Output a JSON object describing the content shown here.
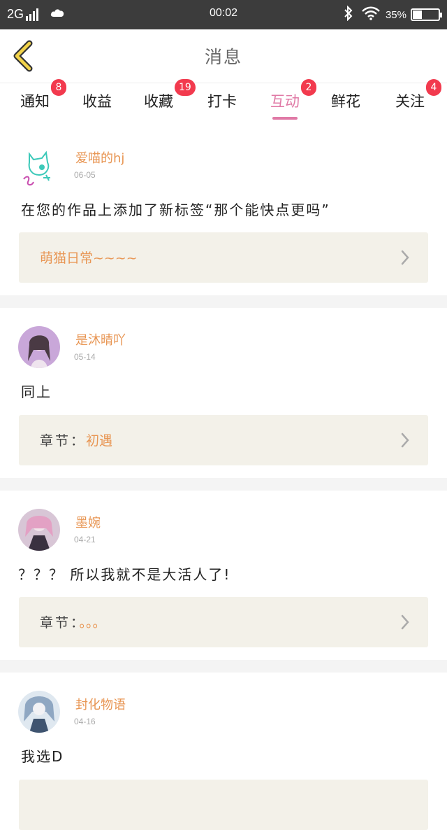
{
  "status_bar": {
    "network": "2G",
    "time": "00:02",
    "battery": "35%",
    "battery_level": 0.35
  },
  "header": {
    "title": "消息"
  },
  "tabs": [
    {
      "label": "通知",
      "badge": "8"
    },
    {
      "label": "收益",
      "badge": ""
    },
    {
      "label": "收藏",
      "badge": "19"
    },
    {
      "label": "打卡",
      "badge": ""
    },
    {
      "label": "互动",
      "badge": "2",
      "active": true
    },
    {
      "label": "鲜花",
      "badge": ""
    },
    {
      "label": "关注",
      "badge": "4"
    }
  ],
  "messages": [
    {
      "user": "爱喵的hj",
      "date": "06-05",
      "text": "在您的作品上添加了新标签“那个能快点更吗”",
      "ref_label": "",
      "ref_value": "萌猫日常~~~~"
    },
    {
      "user": "是沐晴吖",
      "date": "05-14",
      "text": "同上",
      "ref_label": "章节：",
      "ref_value": "初遇"
    },
    {
      "user": "墨婉",
      "date": "04-21",
      "text": "？？？ 所以我就不是大活人了!",
      "ref_label": "章节：",
      "ref_value": "。。。"
    },
    {
      "user": "封化物语",
      "date": "04-16",
      "text": "我选D",
      "ref_label": "",
      "ref_value": ""
    }
  ],
  "colors": {
    "accent": "#e07aa6",
    "username": "#e89654",
    "badge": "#f23a4e",
    "ref_bg": "#f3f1e9"
  },
  "icons": {
    "back": "chevron-left-icon",
    "arrow": "chevron-right-icon"
  }
}
